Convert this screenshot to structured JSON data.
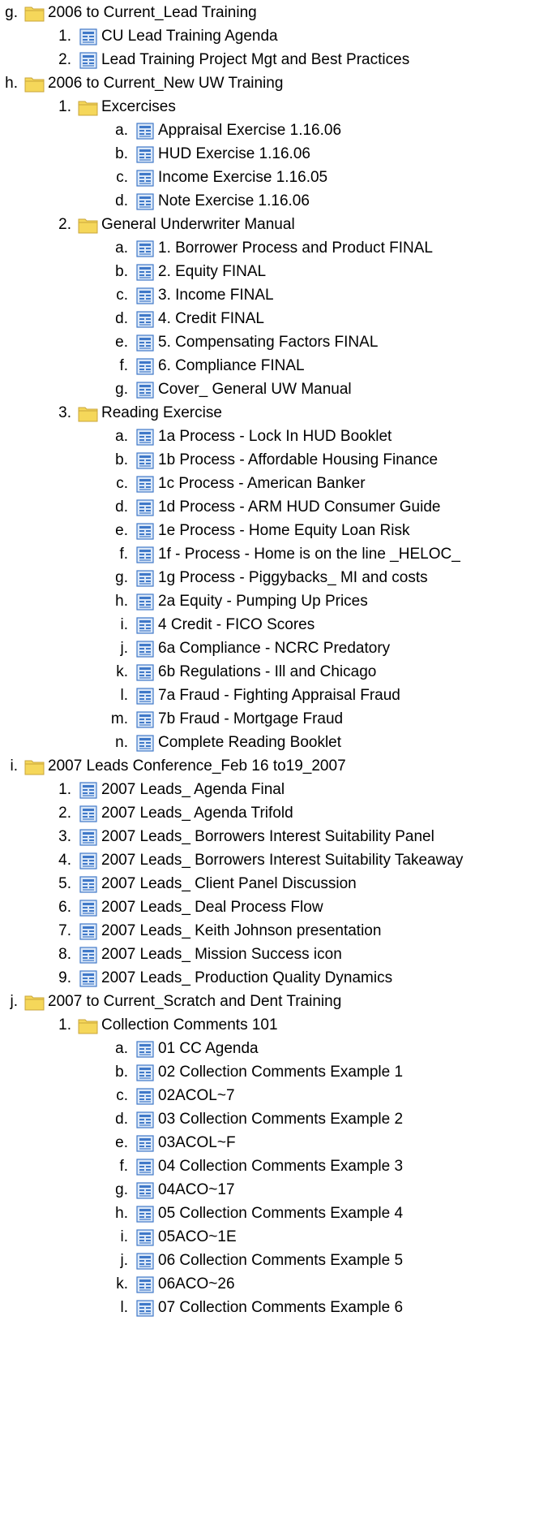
{
  "tree": [
    {
      "marker": "g.",
      "type": "folder",
      "label": "2006 to Current_Lead Training",
      "children": [
        {
          "marker": "1.",
          "type": "doc",
          "label": "CU Lead Training Agenda"
        },
        {
          "marker": "2.",
          "type": "doc",
          "label": "Lead Training Project Mgt and Best Practices"
        }
      ]
    },
    {
      "marker": "h.",
      "type": "folder",
      "label": "2006 to Current_New UW Training",
      "children": [
        {
          "marker": "1.",
          "type": "folder",
          "label": "Excercises",
          "children": [
            {
              "marker": "a.",
              "type": "doc",
              "label": "Appraisal Exercise 1.16.06"
            },
            {
              "marker": "b.",
              "type": "doc",
              "label": "HUD Exercise 1.16.06"
            },
            {
              "marker": "c.",
              "type": "doc",
              "label": "Income Exercise 1.16.05"
            },
            {
              "marker": "d.",
              "type": "doc",
              "label": "Note Exercise 1.16.06"
            }
          ]
        },
        {
          "marker": "2.",
          "type": "folder",
          "label": "General Underwriter Manual",
          "children": [
            {
              "marker": "a.",
              "type": "doc",
              "label": "1. Borrower Process and Product FINAL"
            },
            {
              "marker": "b.",
              "type": "doc",
              "label": "2. Equity FINAL"
            },
            {
              "marker": "c.",
              "type": "doc",
              "label": "3. Income FINAL"
            },
            {
              "marker": "d.",
              "type": "doc",
              "label": "4. Credit FINAL"
            },
            {
              "marker": "e.",
              "type": "doc",
              "label": "5. Compensating Factors FINAL"
            },
            {
              "marker": "f.",
              "type": "doc",
              "label": "6. Compliance FINAL"
            },
            {
              "marker": "g.",
              "type": "doc",
              "label": "Cover_ General UW Manual"
            }
          ]
        },
        {
          "marker": "3.",
          "type": "folder",
          "label": "Reading Exercise",
          "children": [
            {
              "marker": "a.",
              "type": "doc",
              "label": "1a Process - Lock In HUD Booklet"
            },
            {
              "marker": "b.",
              "type": "doc",
              "label": "1b Process - Affordable Housing Finance"
            },
            {
              "marker": "c.",
              "type": "doc",
              "label": "1c Process - American Banker"
            },
            {
              "marker": "d.",
              "type": "doc",
              "label": "1d Process - ARM HUD Consumer Guide"
            },
            {
              "marker": "e.",
              "type": "doc",
              "label": "1e Process - Home Equity Loan Risk"
            },
            {
              "marker": "f.",
              "type": "doc",
              "label": "1f - Process - Home is on the line _HELOC_"
            },
            {
              "marker": "g.",
              "type": "doc",
              "label": "1g Process - Piggybacks_ MI and costs"
            },
            {
              "marker": "h.",
              "type": "doc",
              "label": "2a Equity - Pumping Up Prices"
            },
            {
              "marker": "i.",
              "type": "doc",
              "label": "4 Credit - FICO Scores"
            },
            {
              "marker": "j.",
              "type": "doc",
              "label": "6a Compliance - NCRC Predatory"
            },
            {
              "marker": "k.",
              "type": "doc",
              "label": "6b Regulations - Ill and Chicago"
            },
            {
              "marker": "l.",
              "type": "doc",
              "label": "7a Fraud - Fighting Appraisal Fraud"
            },
            {
              "marker": "m.",
              "type": "doc",
              "label": "7b Fraud - Mortgage Fraud"
            },
            {
              "marker": "n.",
              "type": "doc",
              "label": "Complete Reading Booklet"
            }
          ]
        }
      ]
    },
    {
      "marker": "i.",
      "type": "folder",
      "label": "2007 Leads Conference_Feb 16 to19_2007",
      "children": [
        {
          "marker": "1.",
          "type": "doc",
          "label": "2007 Leads_ Agenda Final"
        },
        {
          "marker": "2.",
          "type": "doc",
          "label": "2007 Leads_ Agenda Trifold"
        },
        {
          "marker": "3.",
          "type": "doc",
          "label": "2007 Leads_ Borrowers Interest Suitability Panel"
        },
        {
          "marker": "4.",
          "type": "doc",
          "label": "2007 Leads_ Borrowers Interest Suitability Takeaway"
        },
        {
          "marker": "5.",
          "type": "doc",
          "label": "2007 Leads_ Client Panel Discussion"
        },
        {
          "marker": "6.",
          "type": "doc",
          "label": "2007 Leads_ Deal Process Flow"
        },
        {
          "marker": "7.",
          "type": "doc",
          "label": "2007 Leads_ Keith Johnson presentation"
        },
        {
          "marker": "8.",
          "type": "doc",
          "label": "2007 Leads_ Mission Success icon"
        },
        {
          "marker": "9.",
          "type": "doc",
          "label": "2007 Leads_ Production Quality Dynamics"
        }
      ]
    },
    {
      "marker": "j.",
      "type": "folder",
      "label": "2007 to Current_Scratch and Dent Training",
      "children": [
        {
          "marker": "1.",
          "type": "folder",
          "label": "Collection Comments 101",
          "children": [
            {
              "marker": "a.",
              "type": "doc",
              "label": "01 CC Agenda"
            },
            {
              "marker": "b.",
              "type": "doc",
              "label": "02 Collection Comments Example 1"
            },
            {
              "marker": "c.",
              "type": "doc",
              "label": "02ACOL~7"
            },
            {
              "marker": "d.",
              "type": "doc",
              "label": "03 Collection Comments Example 2"
            },
            {
              "marker": "e.",
              "type": "doc",
              "label": "03ACOL~F"
            },
            {
              "marker": "f.",
              "type": "doc",
              "label": "04 Collection Comments Example 3"
            },
            {
              "marker": "g.",
              "type": "doc",
              "label": "04ACO~17"
            },
            {
              "marker": "h.",
              "type": "doc",
              "label": "05 Collection Comments Example 4"
            },
            {
              "marker": "i.",
              "type": "doc",
              "label": "05ACO~1E"
            },
            {
              "marker": "j.",
              "type": "doc",
              "label": "06 Collection Comments Example 5"
            },
            {
              "marker": "k.",
              "type": "doc",
              "label": "06ACO~26"
            },
            {
              "marker": "l.",
              "type": "doc",
              "label": "07 Collection Comments Example 6"
            }
          ]
        }
      ]
    }
  ],
  "colors": {
    "folder": "#f5d75a",
    "folder_edge": "#c9a63a",
    "doc_blue": "#3f78c8",
    "doc_light": "#dbe8f8"
  },
  "icons": {
    "folder": "folder-icon",
    "doc": "document-icon"
  }
}
